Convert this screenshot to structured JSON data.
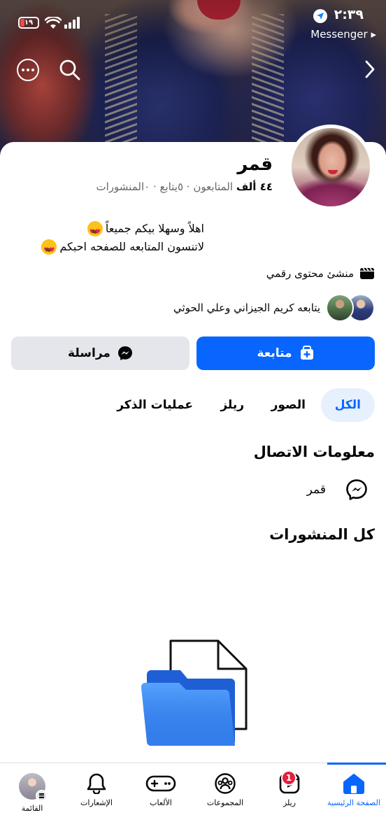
{
  "status_bar": {
    "time": "٢:٣٩",
    "back_app": "Messenger ▸",
    "battery": "١٩"
  },
  "profile": {
    "name": "قمر",
    "followers_count": "٤٤ ألف",
    "followers_label": "المتابعون",
    "following_text": "٥يتابع",
    "posts_text": "٠المنشورات",
    "bio_line_1": "اهلاً وسهلا بيكم جميعاً",
    "bio_line_2": "لاتنسون المتابعه للصفحه احبكم",
    "category": "منشئ محتوى رقمي",
    "followed_by": "يتابعه كريم الجيزاني وعلي الحوثي"
  },
  "actions": {
    "follow_label": "متابعة",
    "message_label": "مراسلة"
  },
  "tabs": [
    {
      "label": "الكل",
      "active": true
    },
    {
      "label": "الصور",
      "active": false
    },
    {
      "label": "ريلز",
      "active": false
    },
    {
      "label": "عمليات الذكر",
      "active": false
    }
  ],
  "contact": {
    "title": "معلومات الاتصال",
    "messenger_name": "قمر"
  },
  "posts": {
    "title": "كل المنشورات"
  },
  "bottom_nav": [
    {
      "label": "الصفحة الرئيسية",
      "icon": "home-icon",
      "active": true
    },
    {
      "label": "ريلز",
      "icon": "reels-icon",
      "badge": "1"
    },
    {
      "label": "المجموعات",
      "icon": "groups-icon"
    },
    {
      "label": "الألعاب",
      "icon": "gaming-icon"
    },
    {
      "label": "الإشعارات",
      "icon": "bell-icon"
    },
    {
      "label": "القائمة",
      "icon": "menu-avatar"
    }
  ],
  "colors": {
    "accent": "#0866ff",
    "secondary_button": "#e4e6eb",
    "active_tab_bg": "#e7f0fd",
    "badge": "#e41e3f"
  }
}
